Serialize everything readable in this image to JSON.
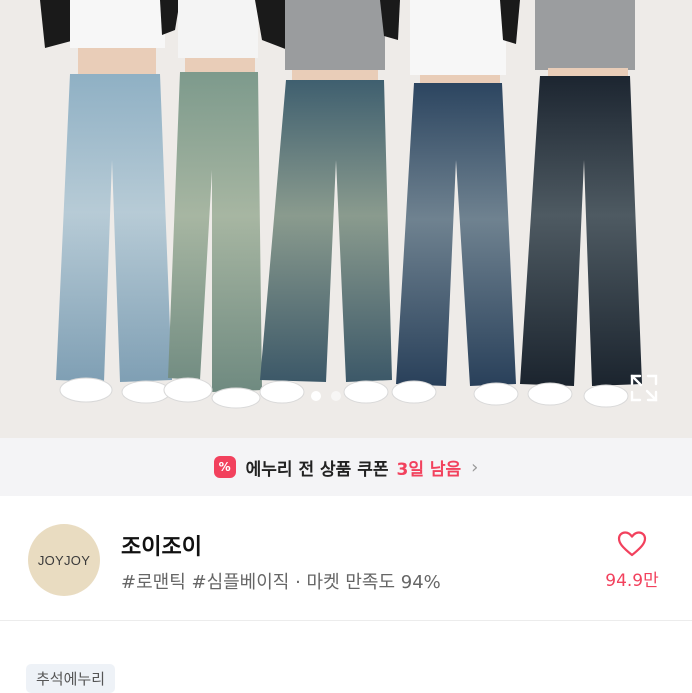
{
  "coupon": {
    "icon": "percent-ticket-icon",
    "text": "에누리 전 상품 쿠폰",
    "remaining": "3일 남음",
    "accent_color": "#f2415d"
  },
  "carousel": {
    "expand_icon": "expand-icon"
  },
  "shop": {
    "logo_text": "JOYJOY",
    "name": "조이조이",
    "meta": "#로맨틱 #심플베이직 · 마켓 만족도 94%",
    "favorite_icon": "heart-outline-icon",
    "favorite_count": "94.9만"
  },
  "tag": "추석에누리"
}
